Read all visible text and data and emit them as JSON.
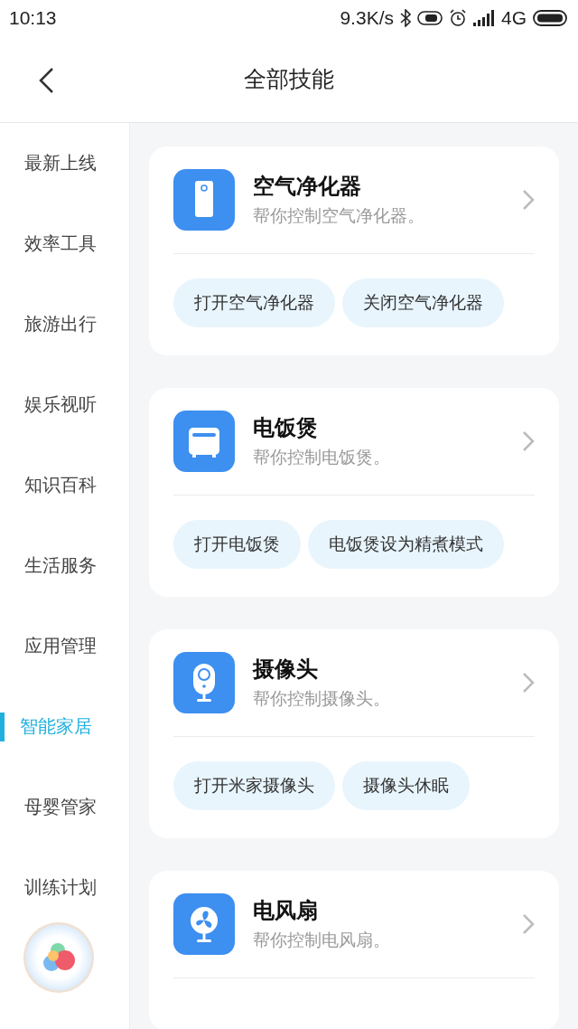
{
  "status_bar": {
    "time": "10:13",
    "speed": "9.3K/s",
    "network": "4G"
  },
  "header": {
    "title": "全部技能"
  },
  "sidebar": {
    "items": [
      {
        "label": "最新上线",
        "selected": false
      },
      {
        "label": "效率工具",
        "selected": false
      },
      {
        "label": "旅游出行",
        "selected": false
      },
      {
        "label": "娱乐视听",
        "selected": false
      },
      {
        "label": "知识百科",
        "selected": false
      },
      {
        "label": "生活服务",
        "selected": false
      },
      {
        "label": "应用管理",
        "selected": false
      },
      {
        "label": "智能家居",
        "selected": true
      },
      {
        "label": "母婴管家",
        "selected": false
      },
      {
        "label": "训练计划",
        "selected": false
      }
    ]
  },
  "skills": [
    {
      "kind": "purifier",
      "title": "空气净化器",
      "subtitle": "帮你控制空气净化器。",
      "chips": [
        "打开空气净化器",
        "关闭空气净化器"
      ]
    },
    {
      "kind": "cooker",
      "title": "电饭煲",
      "subtitle": "帮你控制电饭煲。",
      "chips": [
        "打开电饭煲",
        "电饭煲设为精煮模式"
      ]
    },
    {
      "kind": "camera",
      "title": "摄像头",
      "subtitle": "帮你控制摄像头。",
      "chips": [
        "打开米家摄像头",
        "摄像头休眠"
      ]
    },
    {
      "kind": "fan",
      "title": "电风扇",
      "subtitle": "帮你控制电风扇。"
    }
  ]
}
